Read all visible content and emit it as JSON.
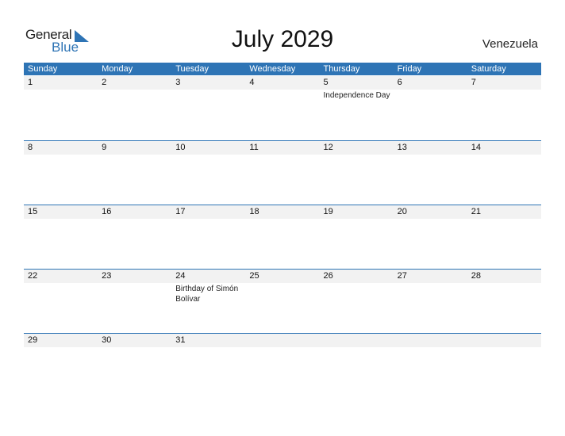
{
  "logo": {
    "line1": "General",
    "line2": "Blue"
  },
  "title": "July 2029",
  "country": "Venezuela",
  "colors": {
    "accent": "#2e74b5",
    "date_strip": "#f2f2f2"
  },
  "weekdays": [
    "Sunday",
    "Monday",
    "Tuesday",
    "Wednesday",
    "Thursday",
    "Friday",
    "Saturday"
  ],
  "weeks": [
    [
      {
        "day": "1",
        "event": ""
      },
      {
        "day": "2",
        "event": ""
      },
      {
        "day": "3",
        "event": ""
      },
      {
        "day": "4",
        "event": ""
      },
      {
        "day": "5",
        "event": "Independence Day"
      },
      {
        "day": "6",
        "event": ""
      },
      {
        "day": "7",
        "event": ""
      }
    ],
    [
      {
        "day": "8",
        "event": ""
      },
      {
        "day": "9",
        "event": ""
      },
      {
        "day": "10",
        "event": ""
      },
      {
        "day": "11",
        "event": ""
      },
      {
        "day": "12",
        "event": ""
      },
      {
        "day": "13",
        "event": ""
      },
      {
        "day": "14",
        "event": ""
      }
    ],
    [
      {
        "day": "15",
        "event": ""
      },
      {
        "day": "16",
        "event": ""
      },
      {
        "day": "17",
        "event": ""
      },
      {
        "day": "18",
        "event": ""
      },
      {
        "day": "19",
        "event": ""
      },
      {
        "day": "20",
        "event": ""
      },
      {
        "day": "21",
        "event": ""
      }
    ],
    [
      {
        "day": "22",
        "event": ""
      },
      {
        "day": "23",
        "event": ""
      },
      {
        "day": "24",
        "event": "Birthday of Simón Bolívar"
      },
      {
        "day": "25",
        "event": ""
      },
      {
        "day": "26",
        "event": ""
      },
      {
        "day": "27",
        "event": ""
      },
      {
        "day": "28",
        "event": ""
      }
    ],
    [
      {
        "day": "29",
        "event": ""
      },
      {
        "day": "30",
        "event": ""
      },
      {
        "day": "31",
        "event": ""
      },
      {
        "day": "",
        "event": ""
      },
      {
        "day": "",
        "event": ""
      },
      {
        "day": "",
        "event": ""
      },
      {
        "day": "",
        "event": ""
      }
    ]
  ]
}
